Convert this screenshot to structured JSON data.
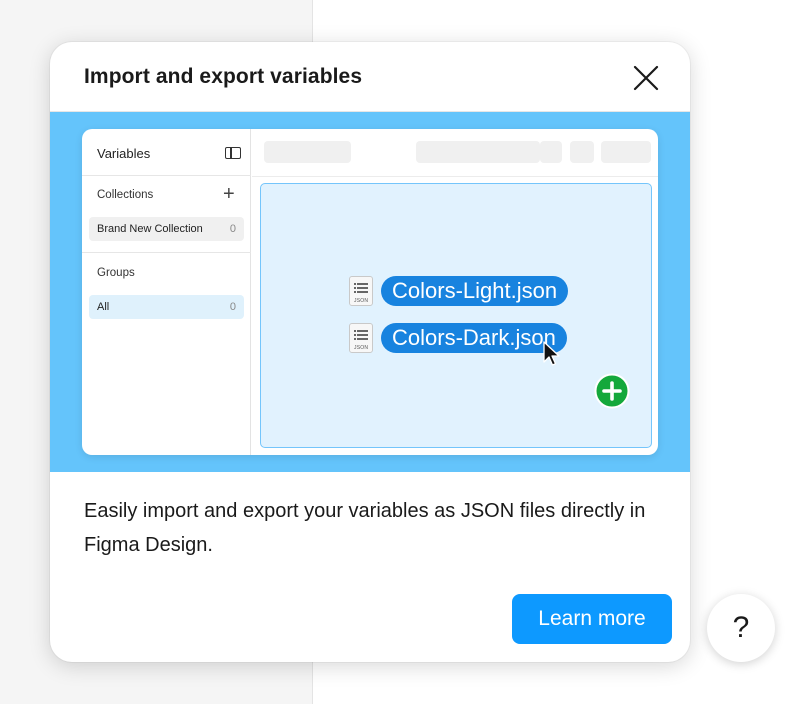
{
  "dialog": {
    "title": "Import and export variables",
    "description": "Easily import and export your variables as JSON files directly in Figma Design.",
    "learn_more_label": "Learn more"
  },
  "illustration": {
    "sidebar_title": "Variables",
    "collections_label": "Collections",
    "collection_name": "Brand New Collection",
    "collection_count": "0",
    "groups_label": "Groups",
    "group_name": "All",
    "group_count": "0",
    "files": [
      {
        "name": "Colors-Light.json",
        "icon_label": "JSON"
      },
      {
        "name": "Colors-Dark.json",
        "icon_label": "JSON"
      }
    ]
  },
  "help": {
    "label": "?"
  },
  "colors": {
    "accent": "#0d99ff",
    "hero_bg": "#64c4fb",
    "file_pill": "#1883df",
    "add_badge": "#14a83b"
  }
}
